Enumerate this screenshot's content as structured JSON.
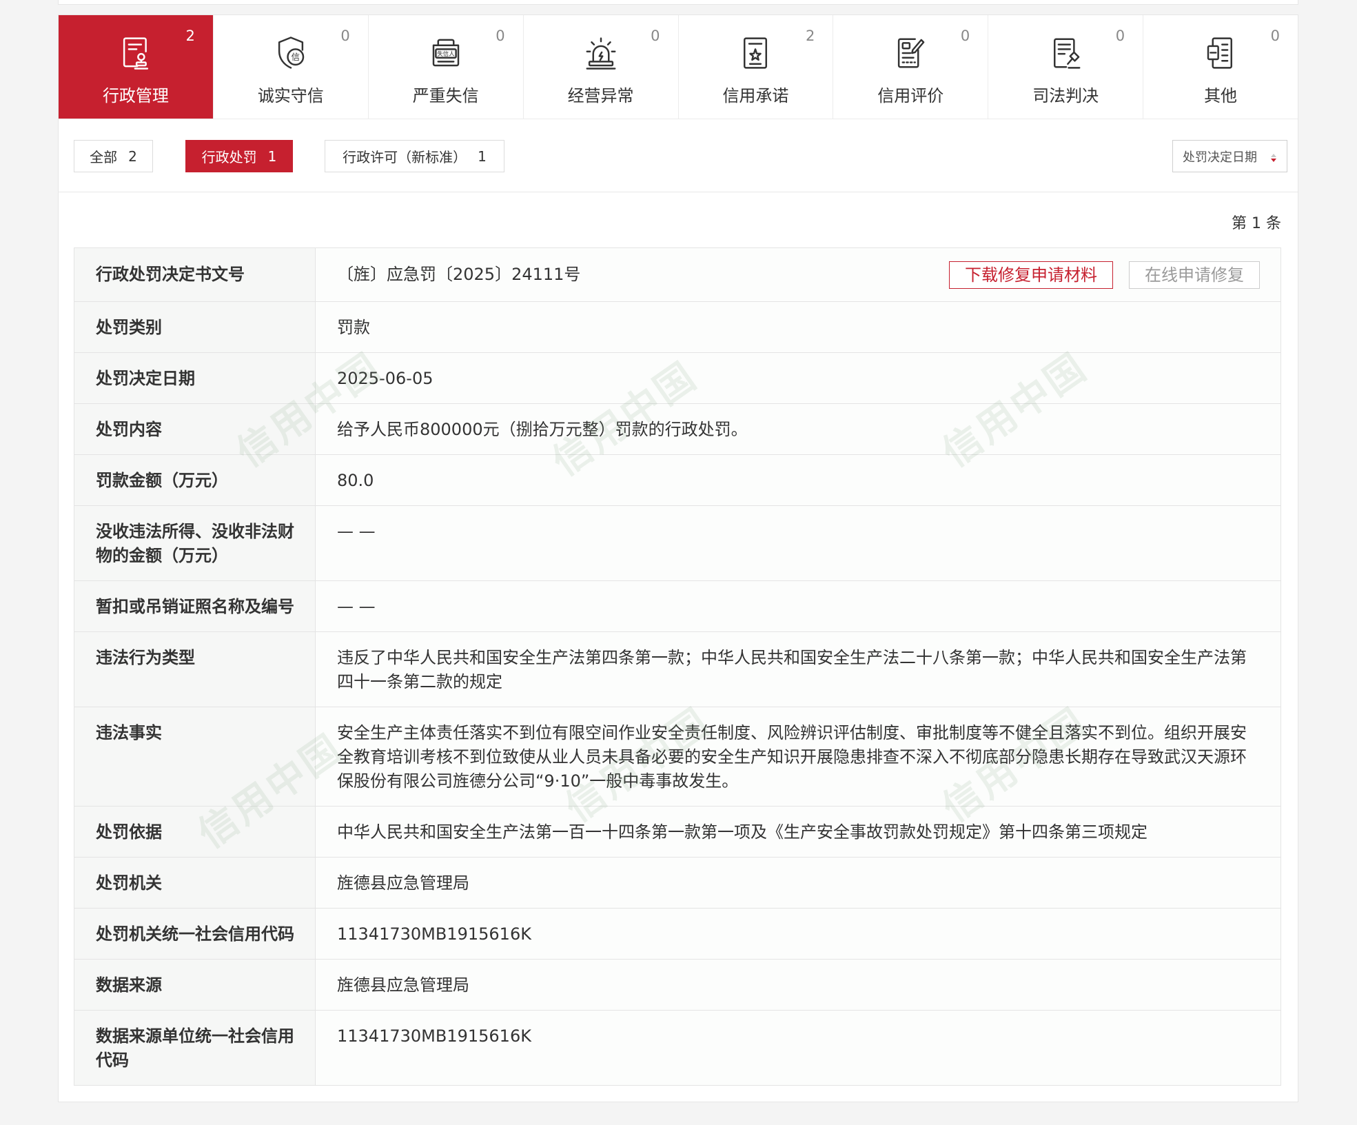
{
  "tabs": [
    {
      "label": "行政管理",
      "count": "2",
      "icon": "document-stamp-icon",
      "active": true
    },
    {
      "label": "诚实守信",
      "count": "0",
      "icon": "shield-credit-icon",
      "icon_text": "信",
      "active": false
    },
    {
      "label": "严重失信",
      "count": "0",
      "icon": "blacklist-folder-icon",
      "icon_text": "失信人",
      "active": false
    },
    {
      "label": "经营异常",
      "count": "0",
      "icon": "alarm-light-icon",
      "active": false
    },
    {
      "label": "信用承诺",
      "count": "2",
      "icon": "document-star-icon",
      "active": false
    },
    {
      "label": "信用评价",
      "count": "0",
      "icon": "clipboard-pen-icon",
      "active": false
    },
    {
      "label": "司法判决",
      "count": "0",
      "icon": "document-gavel-icon",
      "active": false
    },
    {
      "label": "其他",
      "count": "0",
      "icon": "document-grid-icon",
      "active": false
    }
  ],
  "filters": [
    {
      "label": "全部",
      "count": "2",
      "active": false
    },
    {
      "label": "行政处罚",
      "count": "1",
      "active": true
    },
    {
      "label": "行政许可（新标准）",
      "count": "1",
      "active": false
    }
  ],
  "sort": {
    "label": "处罚决定日期",
    "icon": "sort-arrows-icon"
  },
  "pager_text": "第 1 条",
  "actions": {
    "download_label": "下载修复申请材料",
    "apply_label": "在线申请修复"
  },
  "record": {
    "rows": [
      {
        "label": "行政处罚决定书文号",
        "value": "〔旌〕应急罚〔2025〕24111号"
      },
      {
        "label": "处罚类别",
        "value": "罚款"
      },
      {
        "label": "处罚决定日期",
        "value": "2025-06-05"
      },
      {
        "label": "处罚内容",
        "value": "给予人民币800000元（捌拾万元整）罚款的行政处罚。"
      },
      {
        "label": "罚款金额（万元）",
        "value": "80.0"
      },
      {
        "label": "没收违法所得、没收非法财物的金额（万元）",
        "value": "— —"
      },
      {
        "label": "暂扣或吊销证照名称及编号",
        "value": "— —"
      },
      {
        "label": "违法行为类型",
        "value": "违反了中华人民共和国安全生产法第四条第一款；中华人民共和国安全生产法二十八条第一款；中华人民共和国安全生产法第四十一条第二款的规定"
      },
      {
        "label": "违法事实",
        "value": "安全生产主体责任落实不到位有限空间作业安全责任制度、风险辨识评估制度、审批制度等不健全且落实不到位。组织开展安全教育培训考核不到位致使从业人员未具备必要的安全生产知识开展隐患排查不深入不彻底部分隐患长期存在导致武汉天源环保股份有限公司旌德分公司“9·10”一般中毒事故发生。"
      },
      {
        "label": "处罚依据",
        "value": "中华人民共和国安全生产法第一百一十四条第一款第一项及《生产安全事故罚款处罚规定》第十四条第三项规定"
      },
      {
        "label": "处罚机关",
        "value": "旌德县应急管理局"
      },
      {
        "label": "处罚机关统一社会信用代码",
        "value": "11341730MB1915616K"
      },
      {
        "label": "数据来源",
        "value": "旌德县应急管理局"
      },
      {
        "label": "数据来源单位统一社会信用代码",
        "value": "11341730MB1915616K"
      }
    ]
  },
  "watermark_text": "信用中国",
  "colors": {
    "brand_red": "#c6202f",
    "text": "#333333",
    "border": "#e4e4e4",
    "page_bg": "#f4f4f4"
  }
}
